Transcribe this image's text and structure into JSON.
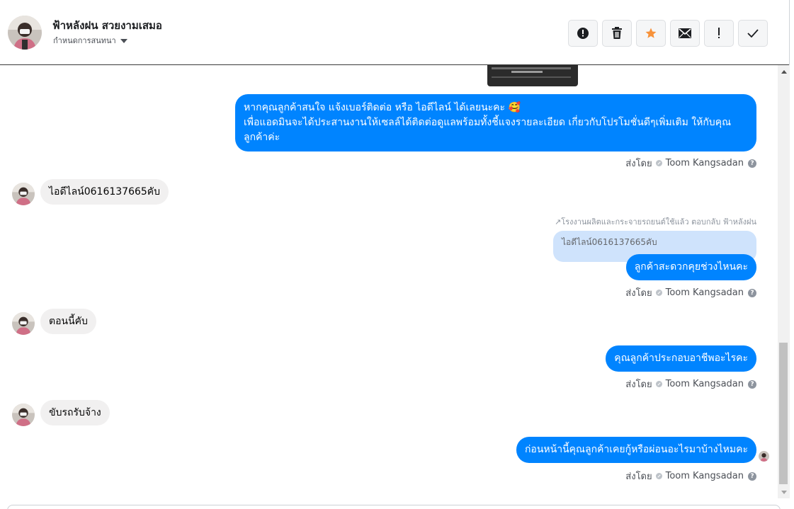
{
  "header": {
    "name": "ฟ้าหลังฝน สวยงามเสมอ",
    "subtitle": "กำหนดการสนทนา",
    "actions": [
      {
        "icon": "alert-circle-icon",
        "name": "mark-spam-button"
      },
      {
        "icon": "trash-icon",
        "name": "delete-button"
      },
      {
        "icon": "star-icon",
        "name": "star-button"
      },
      {
        "icon": "mail-icon",
        "name": "mark-unread-button"
      },
      {
        "icon": "exclamation-icon",
        "name": "follow-up-button"
      },
      {
        "icon": "check-icon",
        "name": "mark-done-button"
      }
    ]
  },
  "colors": {
    "outgoing_bubble": "#0084ff",
    "incoming_bubble": "#f1f0f0",
    "star": "#f7923a",
    "quoted_bubble": "#cfe3fc"
  },
  "messages": {
    "m1": {
      "text": "หากคุณลูกค้าสนใจ แจ้งเบอร์ติดต่อ หรือ ไอดีไลน์ ได้เลยนะคะ 🥰\nเพื่อแอดมินจะได้ประสานงานให้เซลล์ได้ติดต่อดูแลพร้อมทั้งชี้แจงรายละเอียด เกี่ยวกับโปรโมชั่นดีๆเพิ่มเติม ให้กับคุณลูกค้าค่ะ"
    },
    "m2": {
      "text": "ไอดีไลน์0616137665คับ"
    },
    "reply_note": "↗โรงงานผลิตและกระจายรถยนต์ใช้แล้ว ตอบกลับ ฟ้าหลังฝน",
    "quoted": "ไอดีไลน์0616137665คับ",
    "m3": {
      "text": "ลูกค้าสะดวกคุยช่วงไหนคะ"
    },
    "m4": {
      "text": "ตอนนี้คับ"
    },
    "m5": {
      "text": "คุณลูกค้าประกอบอาชีพอะไรคะ"
    },
    "m6": {
      "text": "ขับรถรับจ้าง"
    },
    "m7": {
      "text": "ก่อนหน้านี้คุณลูกค้าเคยกู้หรือผ่อนอะไรมาบ้างไหมคะ"
    }
  },
  "sent_by": {
    "prefix": "ส่งโดย",
    "agent": "Toom Kangsadan",
    "help": "?"
  }
}
